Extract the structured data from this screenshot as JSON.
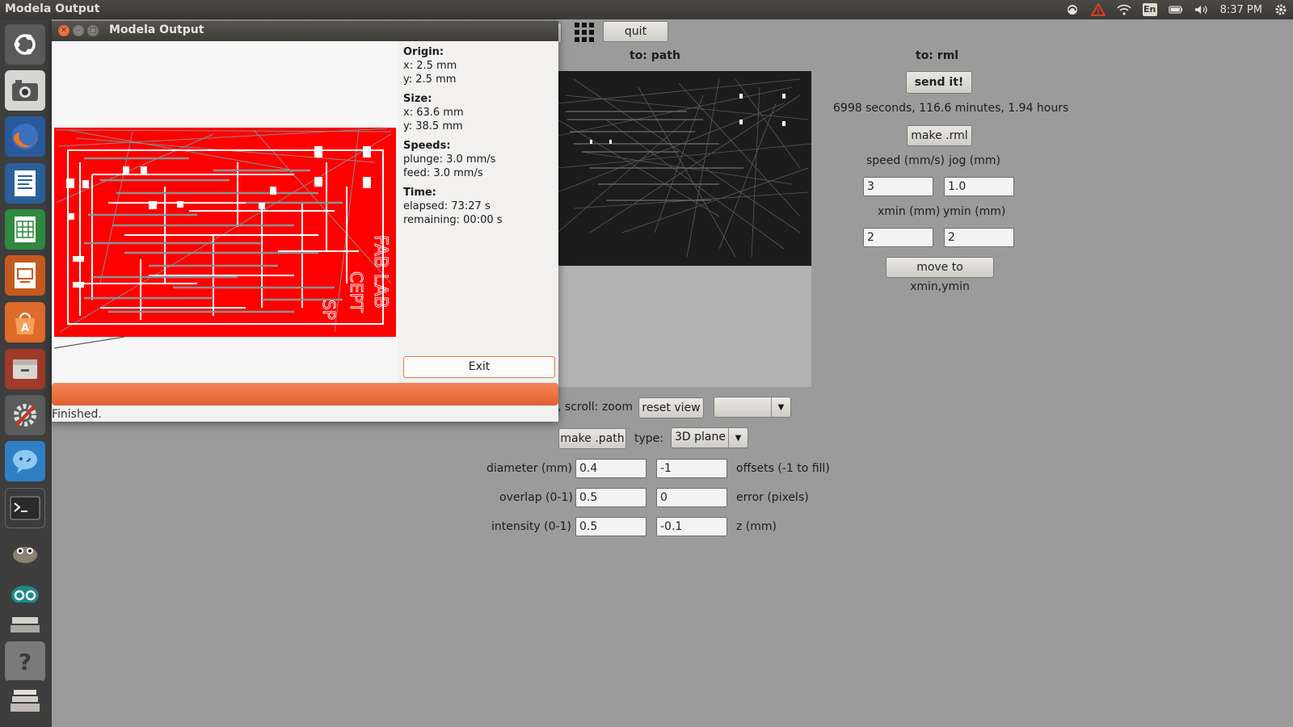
{
  "topbar": {
    "title": "Modela Output",
    "lang": "En",
    "clock": "8:37 PM",
    "icons": [
      "sync-icon",
      "warning-icon",
      "wifi-icon",
      "keyboard-lang-icon",
      "battery-icon",
      "volume-icon",
      "gear-icon"
    ]
  },
  "launcher": {
    "items": [
      "ubuntu-dash-icon",
      "camera-icon",
      "firefox-icon",
      "writer-icon",
      "calc-icon",
      "impress-icon",
      "software-center-icon",
      "files-icon",
      "settings-icon",
      "chat-icon",
      "terminal-icon",
      "gimp-icon",
      "arduino-icon",
      "drive-icon",
      "help-icon",
      "trash-icon"
    ]
  },
  "dialog": {
    "title": "Modela Output",
    "origin_head": "Origin:",
    "origin_x": "x: 2.5 mm",
    "origin_y": "y: 2.5 mm",
    "size_head": "Size:",
    "size_x": "x: 63.6 mm",
    "size_y": "y: 38.5 mm",
    "speeds_head": "Speeds:",
    "plunge": "plunge: 3.0 mm/s",
    "feed": "feed: 3.0 mm/s",
    "time_head": "Time:",
    "elapsed": "elapsed: 73:27 s",
    "remaining": "remaining: 00:00 s",
    "exit_label": "Exit",
    "progress": 1.0,
    "status": "Finished."
  },
  "app": {
    "quit_label": "quit",
    "to_path": "to: path",
    "to_rml": "to: rml",
    "send_label": "send it!",
    "estimate": "6998 seconds, 116.6 minutes, 1.94 hours",
    "make_rml_label": "make .rml",
    "speed_label": "speed (mm/s)",
    "jog_label": "jog (mm)",
    "speed_value": "3",
    "jog_value": "1.0",
    "xmin_label": "xmin (mm)",
    "ymin_label": "ymin (mm)",
    "xmin_value": "2",
    "ymin_value": "2",
    "move_label": "move to xmin,ymin",
    "scroll_hint": ", scroll: zoom",
    "reset_view_label": "reset view",
    "view_select_value": "",
    "make_path_label": "make .path",
    "type_label": "type:",
    "type_value": "3D plane",
    "diameter_label": "diameter (mm)",
    "diameter_value": "0.4",
    "offsets_value": "-1",
    "offsets_label": "offsets (-1 to fill)",
    "overlap_label": "overlap (0-1)",
    "overlap_value": "0.5",
    "error_value": "0",
    "error_label": "error (pixels)",
    "intensity_label": "intensity (0-1)",
    "intensity_value": "0.5",
    "z_value": "-0.1",
    "z_label": "z (mm)"
  },
  "colors": {
    "accent": "#e8683a",
    "board": "#ff0000",
    "toolpath": "#808080"
  }
}
